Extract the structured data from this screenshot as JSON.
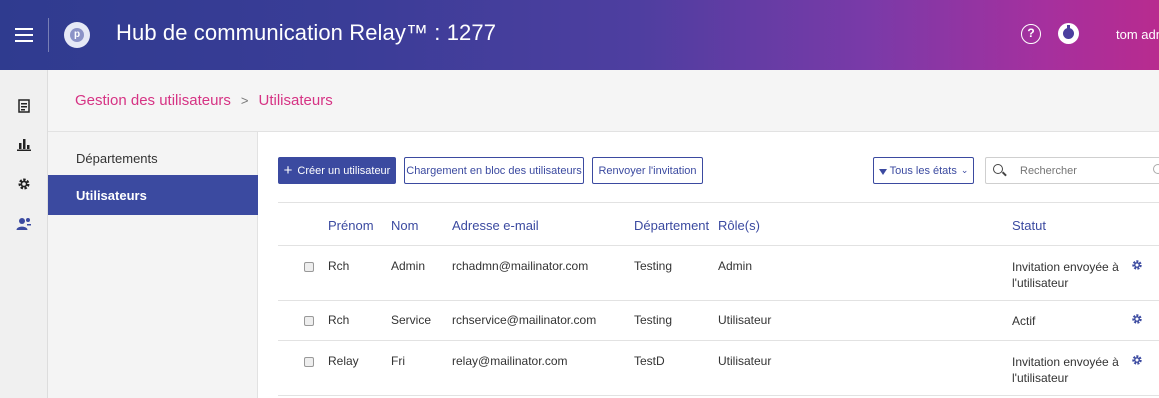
{
  "header": {
    "title": "Hub de communication Relay™ : 1277",
    "user": "tom adm",
    "logo_letter": "p",
    "help_glyph": "?"
  },
  "breadcrumb": {
    "parent": "Gestion des utilisateurs",
    "separator": ">",
    "current": "Utilisateurs"
  },
  "subnav": {
    "items": [
      {
        "label": "Départements",
        "active": false
      },
      {
        "label": "Utilisateurs",
        "active": true
      }
    ]
  },
  "toolbar": {
    "create_label": "Créer un utilisateur",
    "bulk_label": "Chargement en bloc des utilisateurs",
    "resend_label": "Renvoyer l'invitation",
    "filter_label": "Tous les états",
    "search_placeholder": "Rechercher"
  },
  "table": {
    "columns": [
      "Prénom",
      "Nom",
      "Adresse e-mail",
      "Département",
      "Rôle(s)",
      "Statut"
    ],
    "rows": [
      {
        "first": "Rch",
        "last": "Admin",
        "email": "rchadmn@mailinator.com",
        "dept": "Testing",
        "role": "Admin",
        "status": "Invitation envoyée à l'utilisateur"
      },
      {
        "first": "Rch",
        "last": "Service",
        "email": "rchservice@mailinator.com",
        "dept": "Testing",
        "role": "Utilisateur",
        "status": "Actif"
      },
      {
        "first": "Relay",
        "last": "Fri",
        "email": "relay@mailinator.com",
        "dept": "TestD",
        "role": "Utilisateur",
        "status": "Invitation envoyée à l'utilisateur"
      }
    ]
  },
  "icons": {
    "rail": [
      "document-icon",
      "bar-chart-icon",
      "gear-icon",
      "users-icon"
    ]
  },
  "colors": {
    "primary": "#3b4aa0",
    "breadcrumb": "#d63384"
  }
}
